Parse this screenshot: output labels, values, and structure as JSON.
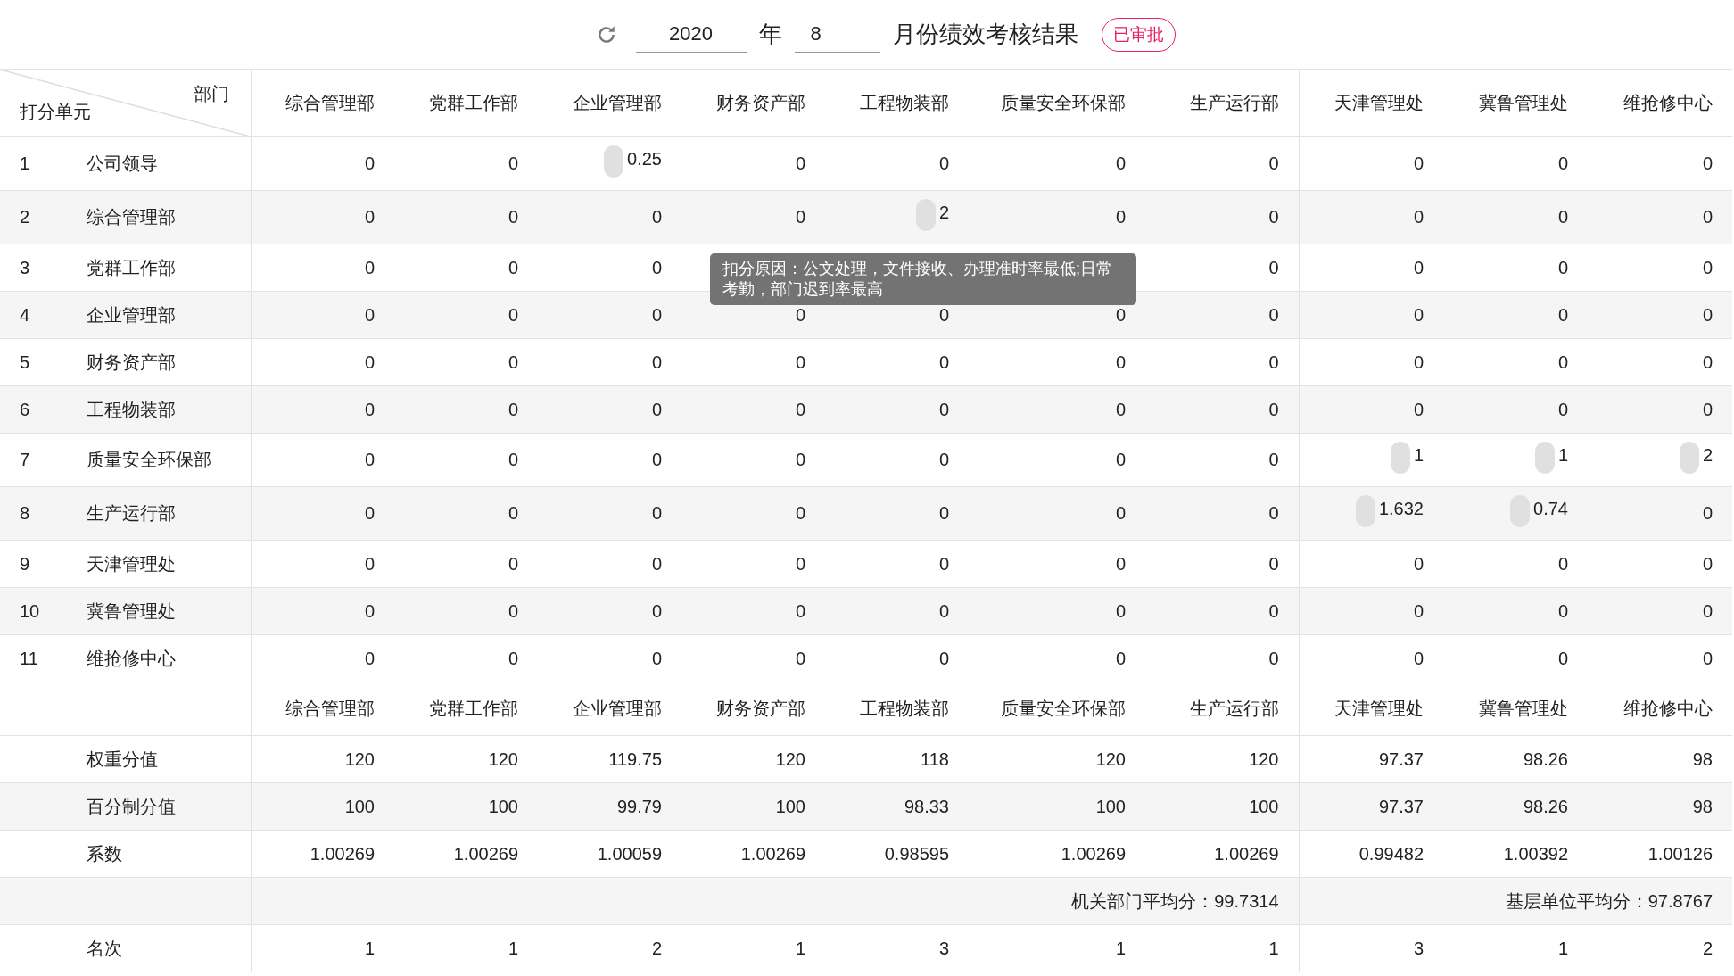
{
  "header": {
    "year": "2020",
    "year_label": "年",
    "month": "8",
    "title": "月份绩效考核结果",
    "status": {
      "label": "已审批",
      "kind": "approved"
    }
  },
  "corner": {
    "top": "部门",
    "bottom": "打分单元"
  },
  "columns": [
    "综合管理部",
    "党群工作部",
    "企业管理部",
    "财务资产部",
    "工程物装部",
    "质量安全环保部",
    "生产运行部",
    "天津管理处",
    "冀鲁管理处",
    "维抢修中心"
  ],
  "rows": [
    {
      "index": "1",
      "name": "公司领导",
      "cells": [
        {
          "value": "0",
          "marked": false
        },
        {
          "value": "0",
          "marked": false
        },
        {
          "value": "0.25",
          "marked": true
        },
        {
          "value": "0",
          "marked": false
        },
        {
          "value": "0",
          "marked": false
        },
        {
          "value": "0",
          "marked": false
        },
        {
          "value": "0",
          "marked": false
        },
        {
          "value": "0",
          "marked": false
        },
        {
          "value": "0",
          "marked": false
        },
        {
          "value": "0",
          "marked": false
        }
      ]
    },
    {
      "index": "2",
      "name": "综合管理部",
      "cells": [
        {
          "value": "0",
          "marked": false
        },
        {
          "value": "0",
          "marked": false
        },
        {
          "value": "0",
          "marked": false
        },
        {
          "value": "0",
          "marked": false
        },
        {
          "value": "2",
          "marked": true
        },
        {
          "value": "0",
          "marked": false
        },
        {
          "value": "0",
          "marked": false
        },
        {
          "value": "0",
          "marked": false
        },
        {
          "value": "0",
          "marked": false
        },
        {
          "value": "0",
          "marked": false
        }
      ]
    },
    {
      "index": "3",
      "name": "党群工作部",
      "cells": [
        {
          "value": "0",
          "marked": false
        },
        {
          "value": "0",
          "marked": false
        },
        {
          "value": "0",
          "marked": false
        },
        {},
        {},
        {},
        {
          "value": "0",
          "marked": false
        },
        {
          "value": "0",
          "marked": false
        },
        {
          "value": "0",
          "marked": false
        },
        {
          "value": "0",
          "marked": false
        }
      ]
    },
    {
      "index": "4",
      "name": "企业管理部",
      "cells": [
        {
          "value": "0",
          "marked": false
        },
        {
          "value": "0",
          "marked": false
        },
        {
          "value": "0",
          "marked": false
        },
        {
          "value": "0",
          "marked": false
        },
        {
          "value": "0",
          "marked": false
        },
        {
          "value": "0",
          "marked": false
        },
        {
          "value": "0",
          "marked": false
        },
        {
          "value": "0",
          "marked": false
        },
        {
          "value": "0",
          "marked": false
        },
        {
          "value": "0",
          "marked": false
        }
      ]
    },
    {
      "index": "5",
      "name": "财务资产部",
      "cells": [
        {
          "value": "0",
          "marked": false
        },
        {
          "value": "0",
          "marked": false
        },
        {
          "value": "0",
          "marked": false
        },
        {
          "value": "0",
          "marked": false
        },
        {
          "value": "0",
          "marked": false
        },
        {
          "value": "0",
          "marked": false
        },
        {
          "value": "0",
          "marked": false
        },
        {
          "value": "0",
          "marked": false
        },
        {
          "value": "0",
          "marked": false
        },
        {
          "value": "0",
          "marked": false
        }
      ]
    },
    {
      "index": "6",
      "name": "工程物装部",
      "cells": [
        {
          "value": "0",
          "marked": false
        },
        {
          "value": "0",
          "marked": false
        },
        {
          "value": "0",
          "marked": false
        },
        {
          "value": "0",
          "marked": false
        },
        {
          "value": "0",
          "marked": false
        },
        {
          "value": "0",
          "marked": false
        },
        {
          "value": "0",
          "marked": false
        },
        {
          "value": "0",
          "marked": false
        },
        {
          "value": "0",
          "marked": false
        },
        {
          "value": "0",
          "marked": false
        }
      ]
    },
    {
      "index": "7",
      "name": "质量安全环保部",
      "cells": [
        {
          "value": "0",
          "marked": false
        },
        {
          "value": "0",
          "marked": false
        },
        {
          "value": "0",
          "marked": false
        },
        {
          "value": "0",
          "marked": false
        },
        {
          "value": "0",
          "marked": false
        },
        {
          "value": "0",
          "marked": false
        },
        {
          "value": "0",
          "marked": false
        },
        {
          "value": "1",
          "marked": true
        },
        {
          "value": "1",
          "marked": true
        },
        {
          "value": "2",
          "marked": true
        }
      ]
    },
    {
      "index": "8",
      "name": "生产运行部",
      "cells": [
        {
          "value": "0",
          "marked": false
        },
        {
          "value": "0",
          "marked": false
        },
        {
          "value": "0",
          "marked": false
        },
        {
          "value": "0",
          "marked": false
        },
        {
          "value": "0",
          "marked": false
        },
        {
          "value": "0",
          "marked": false
        },
        {
          "value": "0",
          "marked": false
        },
        {
          "value": "1.632",
          "marked": true
        },
        {
          "value": "0.74",
          "marked": true
        },
        {
          "value": "0",
          "marked": false
        }
      ]
    },
    {
      "index": "9",
      "name": "天津管理处",
      "cells": [
        {
          "value": "0",
          "marked": false
        },
        {
          "value": "0",
          "marked": false
        },
        {
          "value": "0",
          "marked": false
        },
        {
          "value": "0",
          "marked": false
        },
        {
          "value": "0",
          "marked": false
        },
        {
          "value": "0",
          "marked": false
        },
        {
          "value": "0",
          "marked": false
        },
        {
          "value": "0",
          "marked": false
        },
        {
          "value": "0",
          "marked": false
        },
        {
          "value": "0",
          "marked": false
        }
      ]
    },
    {
      "index": "10",
      "name": "冀鲁管理处",
      "cells": [
        {
          "value": "0",
          "marked": false
        },
        {
          "value": "0",
          "marked": false
        },
        {
          "value": "0",
          "marked": false
        },
        {
          "value": "0",
          "marked": false
        },
        {
          "value": "0",
          "marked": false
        },
        {
          "value": "0",
          "marked": false
        },
        {
          "value": "0",
          "marked": false
        },
        {
          "value": "0",
          "marked": false
        },
        {
          "value": "0",
          "marked": false
        },
        {
          "value": "0",
          "marked": false
        }
      ]
    },
    {
      "index": "11",
      "name": "维抢修中心",
      "cells": [
        {
          "value": "0",
          "marked": false
        },
        {
          "value": "0",
          "marked": false
        },
        {
          "value": "0",
          "marked": false
        },
        {
          "value": "0",
          "marked": false
        },
        {
          "value": "0",
          "marked": false
        },
        {
          "value": "0",
          "marked": false
        },
        {
          "value": "0",
          "marked": false
        },
        {
          "value": "0",
          "marked": false
        },
        {
          "value": "0",
          "marked": false
        },
        {
          "value": "0",
          "marked": false
        }
      ]
    }
  ],
  "tooltip": "扣分原因：公文处理，文件接收、办理准时率最低;日常考勤，部门迟到率最高",
  "summary_columns": [
    "综合管理部",
    "党群工作部",
    "企业管理部",
    "财务资产部",
    "工程物装部",
    "质量安全环保部",
    "生产运行部",
    "天津管理处",
    "冀鲁管理处",
    "维抢修中心"
  ],
  "summary_rows": [
    {
      "label": "权重分值",
      "values": [
        "120",
        "120",
        "119.75",
        "120",
        "118",
        "120",
        "120",
        "97.37",
        "98.26",
        "98"
      ]
    },
    {
      "label": "百分制分值",
      "values": [
        "100",
        "100",
        "99.79",
        "100",
        "98.33",
        "100",
        "100",
        "97.37",
        "98.26",
        "98"
      ]
    },
    {
      "label": "系数",
      "values": [
        "1.00269",
        "1.00269",
        "1.00059",
        "1.00269",
        "0.98595",
        "1.00269",
        "1.00269",
        "0.99482",
        "1.00392",
        "1.00126"
      ]
    }
  ],
  "averages": {
    "office": "机关部门平均分：99.7314",
    "field": "基层单位平均分：97.8767"
  },
  "ranking": {
    "label": "名次",
    "values": [
      "1",
      "1",
      "2",
      "1",
      "3",
      "1",
      "1",
      "3",
      "1",
      "2"
    ]
  }
}
